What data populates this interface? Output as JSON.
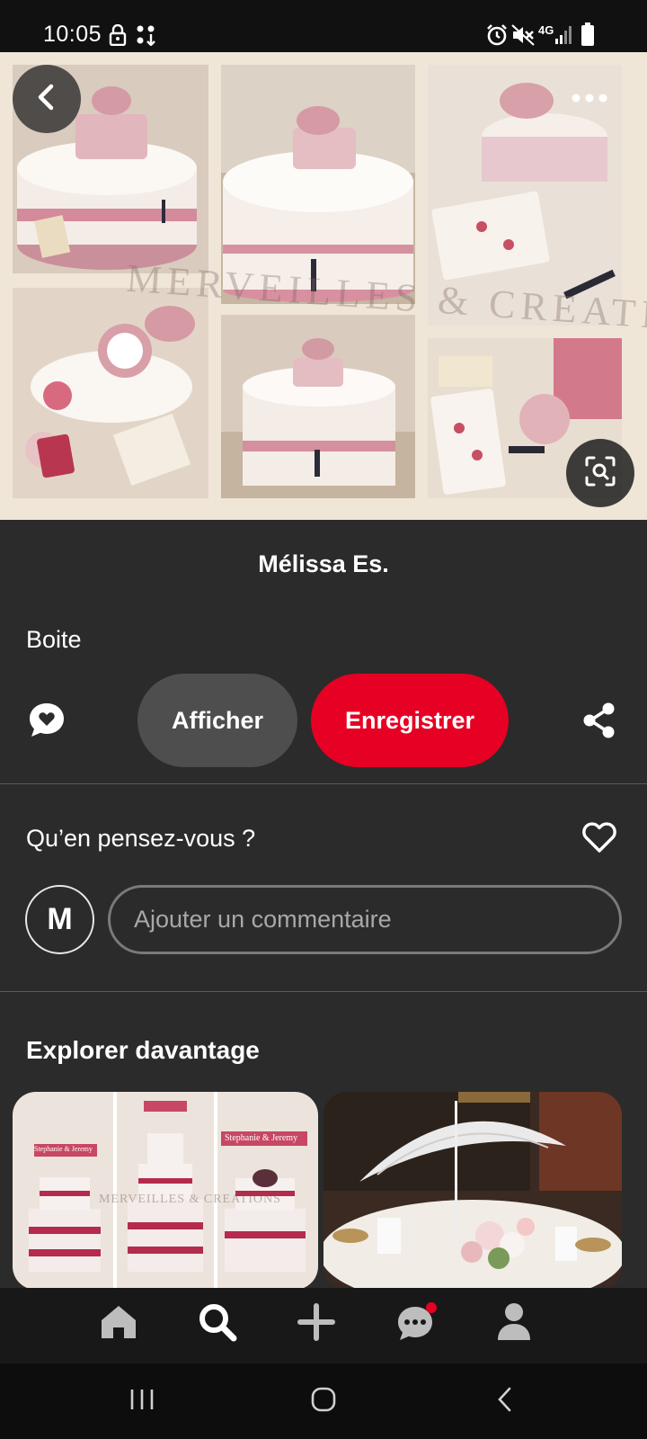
{
  "status_bar": {
    "time": "10:05",
    "network": "4G",
    "icons": [
      "lock-icon",
      "transfer-icon",
      "alarm-icon",
      "mute-icon",
      "signal-icon",
      "battery-icon"
    ]
  },
  "hero": {
    "watermark": "MERVEILLES & CREATIONS",
    "icons": [
      "back-arrow-icon",
      "more-options-icon",
      "visual-search-icon"
    ]
  },
  "pin": {
    "author": "Mélissa Es.",
    "title": "Boite",
    "show_label": "Afficher",
    "save_label": "Enregistrer",
    "colors": {
      "save": "#e60023",
      "show": "#4e4e4e",
      "background": "#2b2b2b"
    }
  },
  "comments": {
    "question": "Qu’en pensez-vous ?",
    "avatar_letter": "M",
    "placeholder": "Ajouter un commentaire"
  },
  "explore": {
    "title": "Explorer davantage",
    "cards": [
      {
        "caption_banner_left": "Stephanie & Jeremy",
        "caption_banner_right": "Stephanie & Jeremy",
        "watermark": "MERVEILLES & CREATIONS"
      },
      {
        "subject": "parasol-table-centerpiece"
      }
    ]
  },
  "bottom_nav": {
    "items": [
      "home-icon",
      "search-icon",
      "add-icon",
      "messages-icon",
      "profile-icon"
    ],
    "active": "search-icon",
    "notification_color": "#e60023"
  },
  "system_nav": [
    "recent-apps-icon",
    "home-circle-icon",
    "back-chevron-icon"
  ]
}
